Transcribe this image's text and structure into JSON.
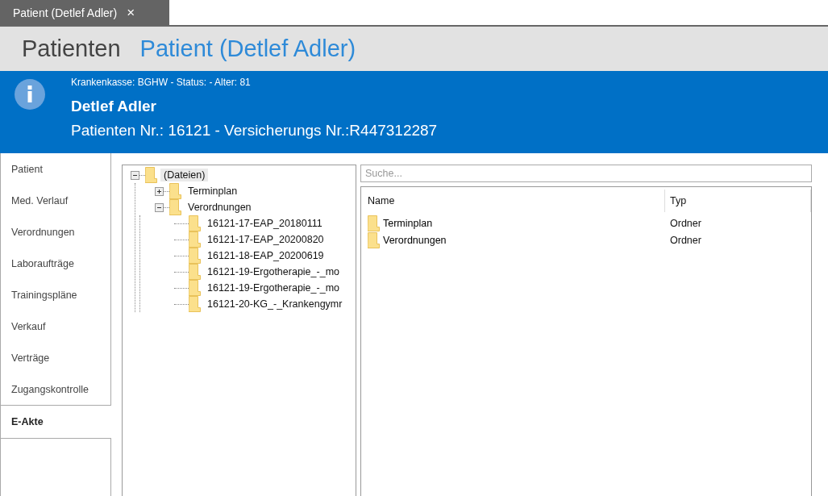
{
  "document_tab": {
    "label": "Patient (Detlef Adler)",
    "close": "×"
  },
  "breadcrumb": [
    {
      "label": "Patienten",
      "selected": false
    },
    {
      "label": "Patient (Detlef Adler)",
      "selected": true
    }
  ],
  "info_banner": {
    "meta": "Krankenkasse: BGHW  -  Status:  - Alter: 81",
    "name": "Detlef Adler",
    "numbers": "Patienten Nr.: 16121  -  Versicherungs Nr.:R447312287"
  },
  "side_tabs": [
    {
      "label": "Patient",
      "selected": false
    },
    {
      "label": "Med. Verlauf",
      "selected": false
    },
    {
      "label": "Verordnungen",
      "selected": false
    },
    {
      "label": "Laboraufträge",
      "selected": false
    },
    {
      "label": "Trainingspläne",
      "selected": false
    },
    {
      "label": "Verkauf",
      "selected": false
    },
    {
      "label": "Verträge",
      "selected": false
    },
    {
      "label": "Zugangskontrolle",
      "selected": false
    },
    {
      "label": "E-Akte",
      "selected": true
    }
  ],
  "tree": [
    {
      "label": "(Dateien)",
      "selected": true,
      "expanded": true,
      "children": [
        {
          "label": "Terminplan",
          "selected": false,
          "expanded": false
        },
        {
          "label": "Verordnungen",
          "selected": false,
          "expanded": true,
          "children": [
            {
              "label": "16121-17-EAP_20180111",
              "selected": false
            },
            {
              "label": "16121-17-EAP_20200820",
              "selected": false
            },
            {
              "label": "16121-18-EAP_20200619",
              "selected": false
            },
            {
              "label": "16121-19-Ergotherapie_-_mo",
              "selected": false
            },
            {
              "label": "16121-19-Ergotherapie_-_mo",
              "selected": false
            },
            {
              "label": "16121-20-KG_-_Krankengymr",
              "selected": false
            }
          ]
        }
      ]
    }
  ],
  "search": {
    "placeholder": "Suche..."
  },
  "file_list": {
    "columns": [
      "Name",
      "Typ"
    ],
    "rows": [
      {
        "name": "Terminplan",
        "type": "Ordner"
      },
      {
        "name": "Verordnungen",
        "type": "Ordner"
      }
    ]
  }
}
